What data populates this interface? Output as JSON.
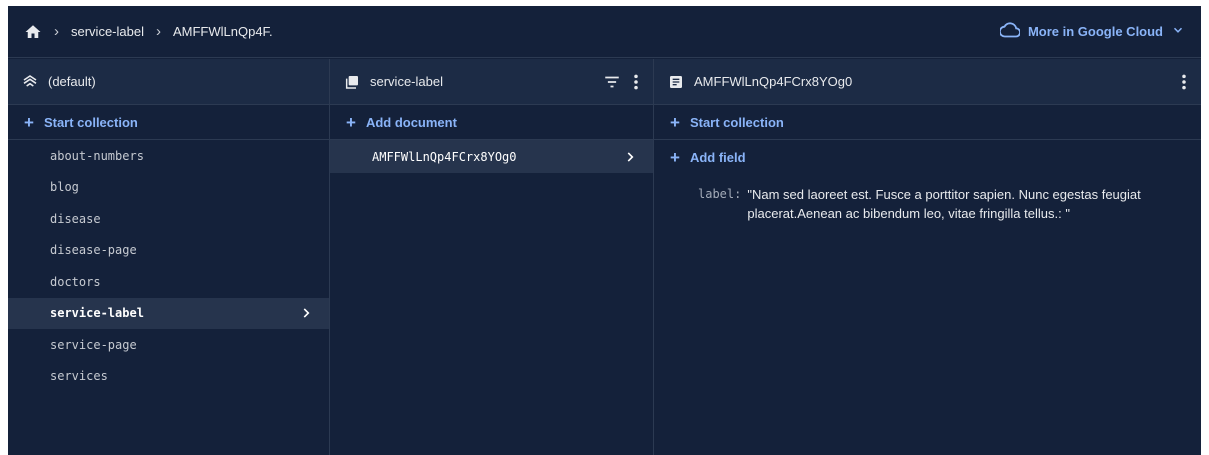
{
  "breadcrumb": {
    "items": [
      "service-label",
      "AMFFWlLnQp4F."
    ]
  },
  "header": {
    "more_label": "More in Google Cloud"
  },
  "col1": {
    "title": "(default)",
    "add_label": "Start collection",
    "items": [
      "about-numbers",
      "blog",
      "disease",
      "disease-page",
      "doctors",
      "service-label",
      "service-page",
      "services"
    ],
    "selected": "service-label"
  },
  "col2": {
    "title": "service-label",
    "add_label": "Add document",
    "items": [
      "AMFFWlLnQp4FCrx8YOg0"
    ]
  },
  "col3": {
    "title": "AMFFWlLnQp4FCrx8YOg0",
    "start_label": "Start collection",
    "add_field_label": "Add field",
    "fields": [
      {
        "key": "label:",
        "value": "\"Nam sed laoreet est. Fusce a porttitor sapien. Nunc egestas feugiat placerat.Aenean ac bibendum leo, vitae fringilla tellus.: \""
      }
    ]
  },
  "colors": {
    "background": "#14213a",
    "accent": "#8ab4f8",
    "selected_row": "#26344d"
  },
  "icons": [
    "home-icon",
    "chevron-right-icon",
    "cloud-icon",
    "chevron-down-icon",
    "database-icon",
    "collection-icon",
    "filter-icon",
    "more-vert-icon",
    "document-icon"
  ]
}
